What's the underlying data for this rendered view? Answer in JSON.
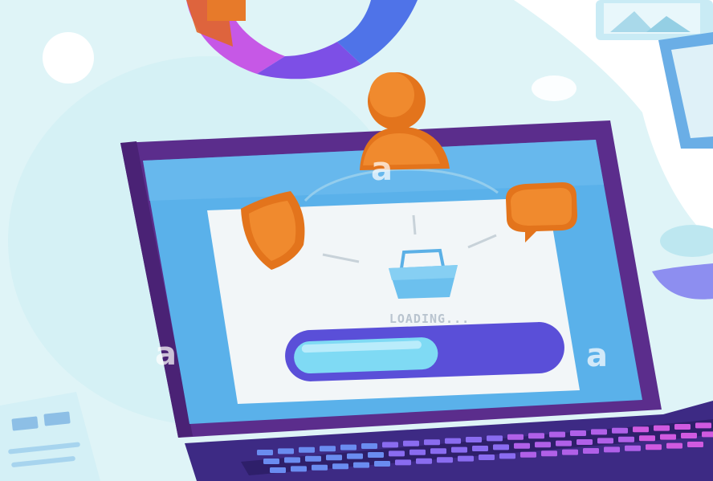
{
  "loading": {
    "label": "LOADING...",
    "progress_percent": 55
  },
  "watermark": {
    "glyph": "a"
  },
  "colors": {
    "background_blob": "#dff4f7",
    "laptop_frame": "#5b2d8c",
    "screen": "#5ab1ea",
    "window": "#f2f6f8",
    "progress_track": "#5a4fd8",
    "progress_fill": "#7fdaf4",
    "accent_orange": "#e3741c",
    "keyboard": "#3d2a84"
  },
  "icons": [
    "user-icon",
    "shield-icon",
    "chat-bubble-icon",
    "shopping-basket-icon",
    "pie-chart-icon",
    "image-card-icon",
    "document-icon"
  ]
}
